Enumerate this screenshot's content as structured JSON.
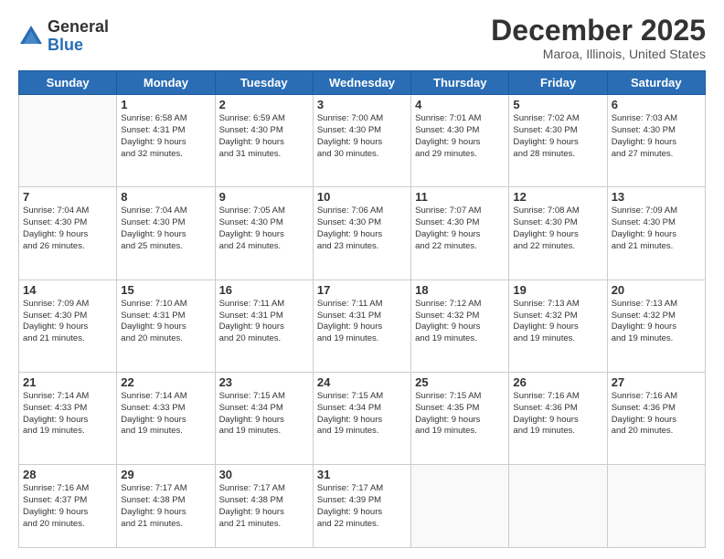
{
  "logo": {
    "general": "General",
    "blue": "Blue"
  },
  "header": {
    "month": "December 2025",
    "location": "Maroa, Illinois, United States"
  },
  "days_of_week": [
    "Sunday",
    "Monday",
    "Tuesday",
    "Wednesday",
    "Thursday",
    "Friday",
    "Saturday"
  ],
  "weeks": [
    [
      {
        "day": "",
        "info": ""
      },
      {
        "day": "1",
        "info": "Sunrise: 6:58 AM\nSunset: 4:31 PM\nDaylight: 9 hours\nand 32 minutes."
      },
      {
        "day": "2",
        "info": "Sunrise: 6:59 AM\nSunset: 4:30 PM\nDaylight: 9 hours\nand 31 minutes."
      },
      {
        "day": "3",
        "info": "Sunrise: 7:00 AM\nSunset: 4:30 PM\nDaylight: 9 hours\nand 30 minutes."
      },
      {
        "day": "4",
        "info": "Sunrise: 7:01 AM\nSunset: 4:30 PM\nDaylight: 9 hours\nand 29 minutes."
      },
      {
        "day": "5",
        "info": "Sunrise: 7:02 AM\nSunset: 4:30 PM\nDaylight: 9 hours\nand 28 minutes."
      },
      {
        "day": "6",
        "info": "Sunrise: 7:03 AM\nSunset: 4:30 PM\nDaylight: 9 hours\nand 27 minutes."
      }
    ],
    [
      {
        "day": "7",
        "info": "Sunrise: 7:04 AM\nSunset: 4:30 PM\nDaylight: 9 hours\nand 26 minutes."
      },
      {
        "day": "8",
        "info": "Sunrise: 7:04 AM\nSunset: 4:30 PM\nDaylight: 9 hours\nand 25 minutes."
      },
      {
        "day": "9",
        "info": "Sunrise: 7:05 AM\nSunset: 4:30 PM\nDaylight: 9 hours\nand 24 minutes."
      },
      {
        "day": "10",
        "info": "Sunrise: 7:06 AM\nSunset: 4:30 PM\nDaylight: 9 hours\nand 23 minutes."
      },
      {
        "day": "11",
        "info": "Sunrise: 7:07 AM\nSunset: 4:30 PM\nDaylight: 9 hours\nand 22 minutes."
      },
      {
        "day": "12",
        "info": "Sunrise: 7:08 AM\nSunset: 4:30 PM\nDaylight: 9 hours\nand 22 minutes."
      },
      {
        "day": "13",
        "info": "Sunrise: 7:09 AM\nSunset: 4:30 PM\nDaylight: 9 hours\nand 21 minutes."
      }
    ],
    [
      {
        "day": "14",
        "info": "Sunrise: 7:09 AM\nSunset: 4:30 PM\nDaylight: 9 hours\nand 21 minutes."
      },
      {
        "day": "15",
        "info": "Sunrise: 7:10 AM\nSunset: 4:31 PM\nDaylight: 9 hours\nand 20 minutes."
      },
      {
        "day": "16",
        "info": "Sunrise: 7:11 AM\nSunset: 4:31 PM\nDaylight: 9 hours\nand 20 minutes."
      },
      {
        "day": "17",
        "info": "Sunrise: 7:11 AM\nSunset: 4:31 PM\nDaylight: 9 hours\nand 19 minutes."
      },
      {
        "day": "18",
        "info": "Sunrise: 7:12 AM\nSunset: 4:32 PM\nDaylight: 9 hours\nand 19 minutes."
      },
      {
        "day": "19",
        "info": "Sunrise: 7:13 AM\nSunset: 4:32 PM\nDaylight: 9 hours\nand 19 minutes."
      },
      {
        "day": "20",
        "info": "Sunrise: 7:13 AM\nSunset: 4:32 PM\nDaylight: 9 hours\nand 19 minutes."
      }
    ],
    [
      {
        "day": "21",
        "info": "Sunrise: 7:14 AM\nSunset: 4:33 PM\nDaylight: 9 hours\nand 19 minutes."
      },
      {
        "day": "22",
        "info": "Sunrise: 7:14 AM\nSunset: 4:33 PM\nDaylight: 9 hours\nand 19 minutes."
      },
      {
        "day": "23",
        "info": "Sunrise: 7:15 AM\nSunset: 4:34 PM\nDaylight: 9 hours\nand 19 minutes."
      },
      {
        "day": "24",
        "info": "Sunrise: 7:15 AM\nSunset: 4:34 PM\nDaylight: 9 hours\nand 19 minutes."
      },
      {
        "day": "25",
        "info": "Sunrise: 7:15 AM\nSunset: 4:35 PM\nDaylight: 9 hours\nand 19 minutes."
      },
      {
        "day": "26",
        "info": "Sunrise: 7:16 AM\nSunset: 4:36 PM\nDaylight: 9 hours\nand 19 minutes."
      },
      {
        "day": "27",
        "info": "Sunrise: 7:16 AM\nSunset: 4:36 PM\nDaylight: 9 hours\nand 20 minutes."
      }
    ],
    [
      {
        "day": "28",
        "info": "Sunrise: 7:16 AM\nSunset: 4:37 PM\nDaylight: 9 hours\nand 20 minutes."
      },
      {
        "day": "29",
        "info": "Sunrise: 7:17 AM\nSunset: 4:38 PM\nDaylight: 9 hours\nand 21 minutes."
      },
      {
        "day": "30",
        "info": "Sunrise: 7:17 AM\nSunset: 4:38 PM\nDaylight: 9 hours\nand 21 minutes."
      },
      {
        "day": "31",
        "info": "Sunrise: 7:17 AM\nSunset: 4:39 PM\nDaylight: 9 hours\nand 22 minutes."
      },
      {
        "day": "",
        "info": ""
      },
      {
        "day": "",
        "info": ""
      },
      {
        "day": "",
        "info": ""
      }
    ]
  ]
}
